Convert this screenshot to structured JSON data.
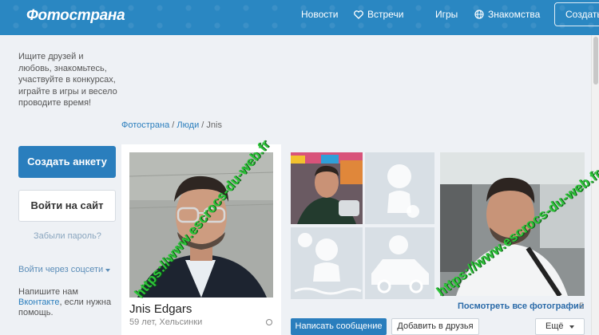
{
  "header": {
    "logo": "Фотострана",
    "nav": {
      "news": "Новости",
      "meetings": "Встречи",
      "games": "Игры",
      "dating": "Знакомства"
    },
    "create_button": "Создать"
  },
  "sidebar": {
    "promo_text": "Ищите друзей и любовь, знакомьтесь, участвуйте в конкурсах, играйте в игры и весело проводите время!",
    "create_profile_button": "Создать анкету",
    "login_button": "Войти на сайт",
    "forgot_password": "Забыли пароль?",
    "social_login": "Войти через соцсети",
    "write_us_prefix": "Напишите нам",
    "write_us_link": "Вконтакте",
    "write_us_suffix": ", если нужна помощь."
  },
  "breadcrumb": {
    "root": "Фотострана",
    "sep": " / ",
    "people": "Люди",
    "current": "Jnis"
  },
  "profile": {
    "name": "Jnis Edgars",
    "meta": "59 лет, Хельсинки"
  },
  "photos": {
    "view_all": "Посмотреть все фотографии",
    "count": "5"
  },
  "actions": {
    "message": "Написать сообщение",
    "add_friend": "Добавить в друзья",
    "more": "Ещё"
  },
  "watermark": {
    "text": "https://www.escrocs-du-web.fr"
  },
  "colors": {
    "header_bg": "#2a87c2",
    "primary": "#2a7ebd",
    "watermark": "#2ec43a",
    "placeholder": "#d8dfe5"
  },
  "icons": [
    "heart-icon",
    "globe-icon",
    "chevron-down-icon",
    "online-status-icon"
  ]
}
